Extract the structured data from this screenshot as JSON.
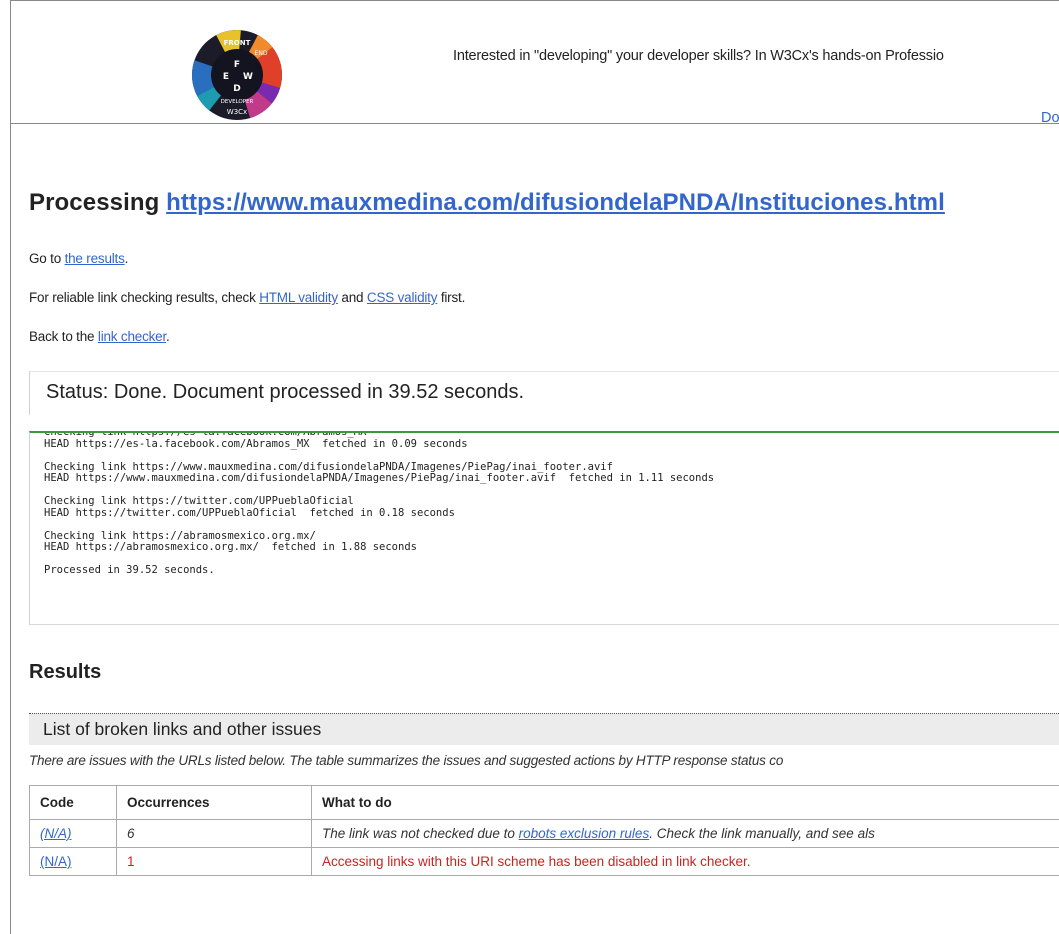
{
  "banner": {
    "logo_text": {
      "top": "FRONT",
      "side": "END",
      "letters": [
        "F",
        "E",
        "W",
        "D"
      ],
      "bottom": "DEVELOPER",
      "brand": "W3Cx"
    },
    "text": "Interested in \"developing\" your developer skills? In W3Cx's hands-on Professio",
    "link": "Do"
  },
  "processing": {
    "label": "Processing ",
    "url": "https://www.mauxmedina.com/difusiondelaPNDA/Instituciones.html"
  },
  "goto": {
    "prefix": "Go to ",
    "link": "the results",
    "suffix": "."
  },
  "reliable": {
    "prefix": "For reliable link checking results, check ",
    "link1": "HTML validity",
    "mid": " and ",
    "link2": "CSS validity",
    "suffix": " first."
  },
  "back": {
    "prefix": "Back to the ",
    "link": "link checker",
    "suffix": "."
  },
  "status": "Status: Done. Document processed in 39.52 seconds.",
  "log": [
    "Checking link https://es-la.facebook.com/Abramos_MX",
    "HEAD https://es-la.facebook.com/Abramos_MX  fetched in 0.09 seconds",
    "",
    "Checking link https://www.mauxmedina.com/difusiondelaPNDA/Imagenes/PiePag/inai_footer.avif",
    "HEAD https://www.mauxmedina.com/difusiondelaPNDA/Imagenes/PiePag/inai_footer.avif  fetched in 1.11 seconds",
    "",
    "Checking link https://twitter.com/UPPueblaOficial",
    "HEAD https://twitter.com/UPPueblaOficial  fetched in 0.18 seconds",
    "",
    "Checking link https://abramosmexico.org.mx/",
    "HEAD https://abramosmexico.org.mx/  fetched in 1.88 seconds",
    "",
    "Processed in 39.52 seconds."
  ],
  "results_heading": "Results",
  "issues_title": "List of broken links and other issues",
  "summary": "There are issues with the URLs listed below. The table summarizes the issues and suggested actions by HTTP response status co",
  "table": {
    "headers": [
      "Code",
      "Occurrences",
      "What to do"
    ],
    "rows": [
      {
        "code": "(N/A)",
        "occurrences": "6",
        "prefix": "The link was not checked due to ",
        "link": "robots exclusion rules",
        "suffix": ". Check the link manually, and see als"
      },
      {
        "code": "(N/A)",
        "occurrences": "1",
        "text": "Accessing links with this URI scheme has been disabled in link checker."
      }
    ]
  },
  "colors": {
    "link": "#3366cc",
    "error": "#cc2222",
    "log_border": "#3a9a3a"
  }
}
